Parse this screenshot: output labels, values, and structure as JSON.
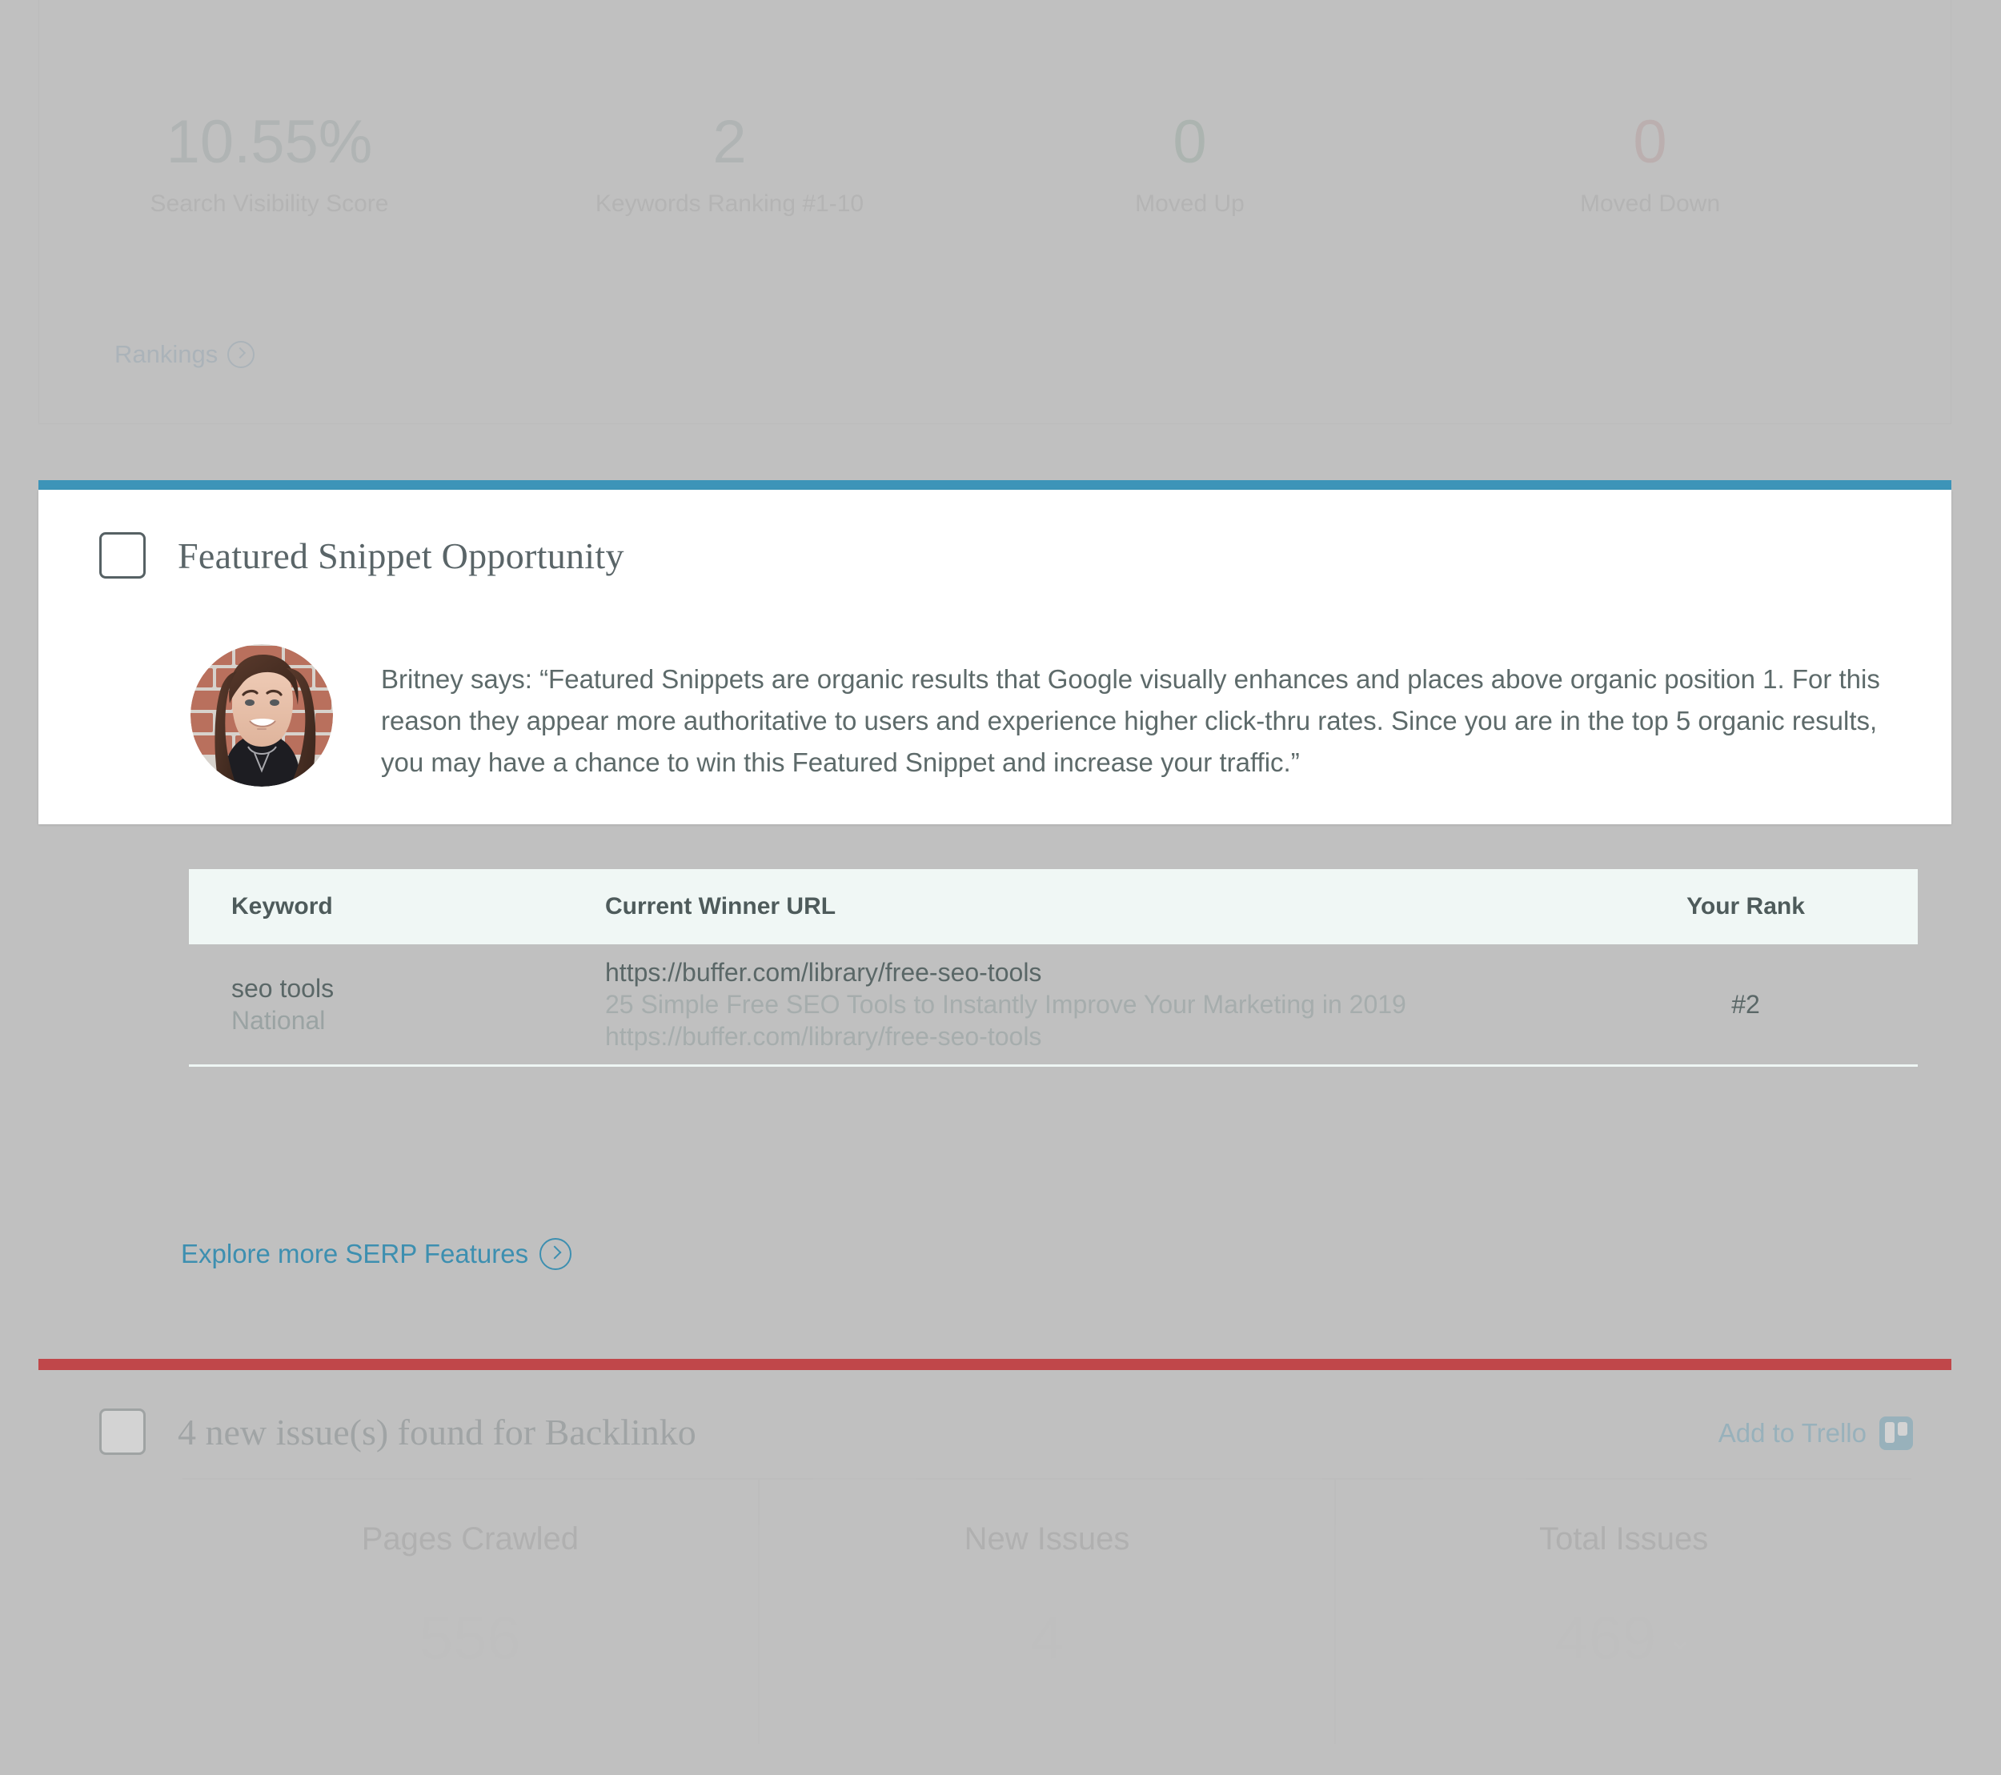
{
  "top_panel": {
    "stats": [
      {
        "value": "10.55%",
        "label": "Search Visibility Score",
        "tone": "neutral"
      },
      {
        "value": "2",
        "label": "Keywords Ranking #1-10",
        "tone": "neutral"
      },
      {
        "value": "0",
        "label": "Moved Up",
        "tone": "green"
      },
      {
        "value": "0",
        "label": "Moved Down",
        "tone": "red"
      }
    ],
    "rankings_link": "Rankings"
  },
  "snippet_card": {
    "accent_color": "#3d94b8",
    "title": "Featured Snippet Opportunity",
    "checkbox_checked": false,
    "quote": "Britney says: “Featured Snippets are organic results that Google visually enhances and places above organic position 1. For this reason they appear more authoritative to users and experience higher click-thru rates. Since you are in the top 5 organic results, you may have a chance to win this Featured Snippet and increase your traffic.”",
    "table": {
      "headers": [
        "Keyword",
        "Current Winner URL",
        "Your Rank"
      ],
      "rows": [
        {
          "keyword": "seo tools",
          "scope": "National",
          "url_main": "https://buffer.com/library/free-seo-tools",
          "url_title": "25 Simple Free SEO Tools to Instantly Improve Your Marketing in 2019",
          "url_display": "https://buffer.com/library/free-seo-tools",
          "rank": "#2"
        }
      ]
    },
    "explore_link": "Explore more SERP Features"
  },
  "issues_card": {
    "accent_color": "#c0474a",
    "title": "4 new issue(s) found for Backlinko",
    "checkbox_checked": false,
    "trello_label": "Add to Trello",
    "stats": [
      {
        "label": "Pages Crawled",
        "value": "556",
        "caret": ""
      },
      {
        "label": "New Issues",
        "value": "4",
        "caret": ""
      },
      {
        "label": "Total Issues",
        "value": "469",
        "caret": "⌄"
      }
    ]
  }
}
